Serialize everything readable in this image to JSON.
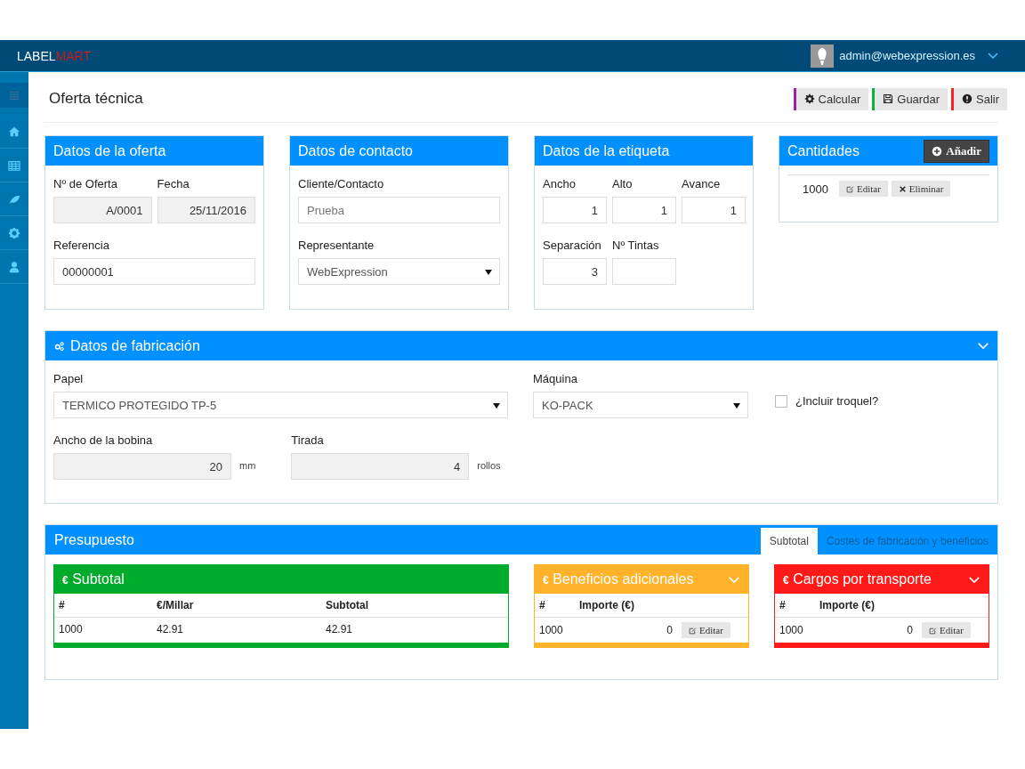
{
  "app": {
    "logo_left": "LABEL",
    "logo_right": "MART",
    "user": "admin@webexpression.es"
  },
  "sidebar": {
    "items": [
      {
        "selected": true
      },
      {
        "selected": false
      },
      {
        "selected": false
      },
      {
        "selected": false
      },
      {
        "selected": false
      },
      {
        "selected": false
      }
    ]
  },
  "page": {
    "title": "Oferta técnica",
    "actions": [
      {
        "label": "Calcular",
        "color": "#a020a0"
      },
      {
        "label": "Guardar",
        "color": "#10b040"
      },
      {
        "label": "Salir",
        "color": "#ff2020"
      }
    ]
  },
  "oferta": {
    "title": "Datos de la oferta",
    "numero_label": "Nº de Oferta",
    "numero": "A/0001",
    "fecha_label": "Fecha",
    "fecha": "25/11/2016",
    "referencia_label": "Referencia",
    "referencia": "00000001"
  },
  "contacto": {
    "title": "Datos de contacto",
    "cliente_label": "Cliente/Contacto",
    "cliente": "Prueba",
    "representante_label": "Representante",
    "representante": "WebExpression"
  },
  "etiqueta": {
    "title": "Datos de la etiqueta",
    "fields": [
      {
        "label": "Ancho",
        "value": "1"
      },
      {
        "label": "Alto",
        "value": "1"
      },
      {
        "label": "Avance",
        "value": "1"
      },
      {
        "label": "Separación",
        "value": "3"
      },
      {
        "label": "Nº Tintas"
      }
    ]
  },
  "cantidades": {
    "title": "Cantidades",
    "add_label": "Añadir",
    "rows": [
      {
        "quantity": "1000",
        "edit": "Editar",
        "delete": "Eliminar"
      }
    ]
  },
  "fabricacion": {
    "title": "Datos de fabricación",
    "papel_label": "Papel",
    "papel": "TERMICO PROTEGIDO TP-5",
    "maquina_label": "Máquina",
    "maquina": "KO-PACK",
    "troquel_label": "¿Incluir troquel?",
    "troquel_checked": false,
    "bobina_label": "Ancho de la bobina",
    "bobina": "20",
    "bobina_unit": "mm",
    "tirada_label": "Tirada",
    "tirada": "4",
    "tirada_unit": "rollos"
  },
  "presupuesto": {
    "title": "Presupuesto",
    "tabs": [
      {
        "label": "Subtotal",
        "selected": true
      },
      {
        "label": "Costes de fabricación y beneficios",
        "selected": false
      }
    ],
    "boxes": [
      {
        "kind": "subtotal",
        "currency": "€",
        "title": "Subtotal",
        "color": "#00aa2a",
        "columns": [
          "#",
          "€/Millar",
          "Subtotal"
        ],
        "rows": [
          [
            "1000",
            "42.91",
            "42.91"
          ]
        ]
      },
      {
        "kind": "charges",
        "currency": "€",
        "title": "Beneficios adicionales",
        "color": "#ffb22a",
        "columns": [
          "#",
          "Importe (€)"
        ],
        "rows": [
          [
            "1000",
            "0"
          ]
        ],
        "edit": "Editar"
      },
      {
        "kind": "charges",
        "currency": "€",
        "title": "Cargos por transporte",
        "color": "#ff1a1a",
        "columns": [
          "#",
          "Importe (€)"
        ],
        "rows": [
          [
            "1000",
            "0"
          ]
        ],
        "edit": "Editar"
      }
    ]
  }
}
